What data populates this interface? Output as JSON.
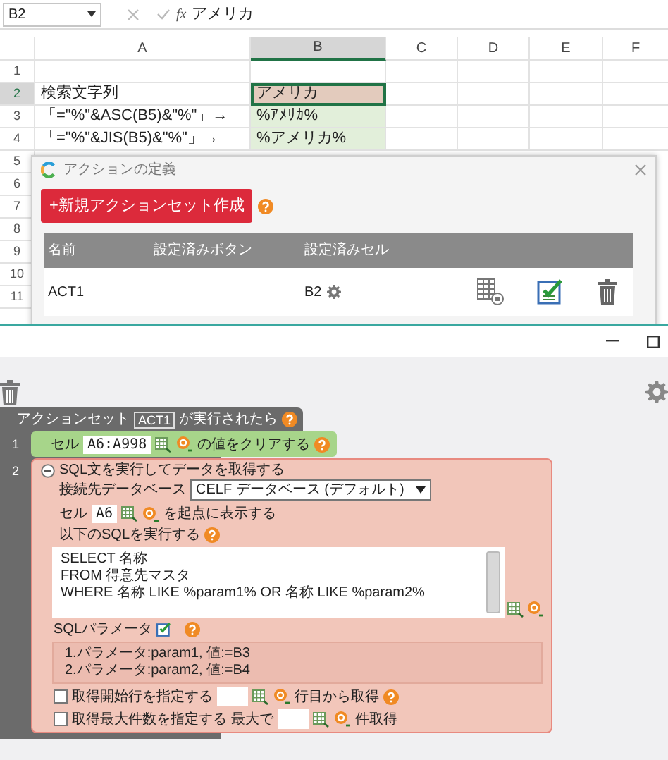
{
  "formula_bar": {
    "name_box": "B2",
    "function_label": "fx",
    "value": "アメリカ"
  },
  "sheet": {
    "columns": [
      {
        "label": "A",
        "selected": false
      },
      {
        "label": "B",
        "selected": true
      },
      {
        "label": "C",
        "selected": false
      },
      {
        "label": "D",
        "selected": false
      },
      {
        "label": "E",
        "selected": false
      },
      {
        "label": "F",
        "selected": false
      }
    ],
    "rows": [
      {
        "number": "1",
        "selected": false
      },
      {
        "number": "2",
        "selected": true,
        "a": "検索文字列",
        "b": "アメリカ",
        "color": "#e3cbbd"
      },
      {
        "number": "3",
        "selected": false,
        "a": "「=\"%\"&ASC(B5)&\"%\"」→",
        "b": "%ｱﾒﾘｶ%",
        "color": "#e2efda"
      },
      {
        "number": "4",
        "selected": false,
        "a": "「=\"%\"&JIS(B5)&\"%\"」→",
        "b": "%アメリカ%",
        "color": "#e2efda"
      }
    ],
    "covered_row_numbers": [
      "5",
      "6",
      "7",
      "8",
      "9",
      "10",
      "11"
    ]
  },
  "dialog": {
    "title": "アクションの定義",
    "new_button": "+新規アクションセット作成",
    "columns": [
      "名前",
      "設定済みボタン",
      "設定済みセル"
    ],
    "rows": [
      {
        "name": "ACT1",
        "cell": "B2"
      }
    ]
  },
  "editor": {
    "action_set": {
      "prefix": "アクションセット",
      "name": "ACT1",
      "suffix": "が実行されたら"
    },
    "steps": [
      {
        "number": "1",
        "kind": "clear",
        "label": "セル",
        "range": "A6:A998",
        "suffix": "の値をクリアする"
      },
      {
        "number": "2",
        "kind": "sql",
        "expanded": true,
        "title": "SQL文を実行してデータを取得する",
        "db_label": "接続先データベース",
        "db_value": "CELF データベース (デフォルト)",
        "cell_label": "セル",
        "cell_value": "A6",
        "cell_suffix": "を起点に表示する",
        "sql_label": "以下のSQLを実行する",
        "sql_lines": [
          "SELECT 名称",
          "FROM 得意先マスタ",
          "WHERE 名称 LIKE %param1% OR 名称 LIKE %param2%"
        ],
        "param_label": "SQLパラメータ",
        "params": [
          "1.パラメータ:param1, 値:=B3",
          "2.パラメータ:param2, 値:=B4"
        ],
        "options": [
          {
            "checked": false,
            "label": "取得開始行を指定する",
            "suffix": "行目から取得",
            "help": true
          },
          {
            "checked": false,
            "label": "取得最大件数を指定する",
            "prefix": "最大で",
            "suffix": "件取得",
            "help": false
          }
        ]
      }
    ]
  }
}
